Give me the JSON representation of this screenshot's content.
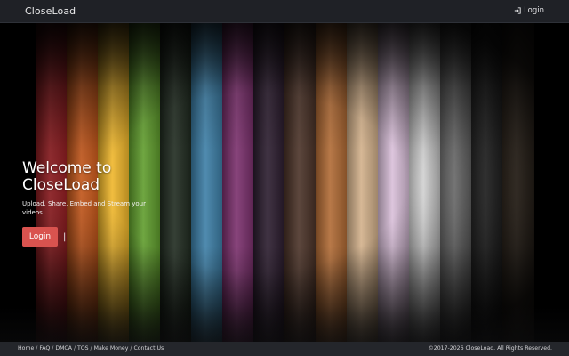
{
  "navbar": {
    "brand": "CloseLoad",
    "login_label": "Login",
    "login_icon": "sign-in-icon"
  },
  "hero": {
    "title_line1": "Welcome to",
    "title_line2": "CloseLoad",
    "subtitle": "Upload, Share, Embed and Stream your videos.",
    "login_button": "Login",
    "background_stripe_colors": [
      "#c1272d",
      "#e0641f",
      "#efb62a",
      "#5f9c2c",
      "#1f2a1f",
      "#3c7ea6",
      "#7a2f6c",
      "#2b1c2e",
      "#4a3227",
      "#b06a34",
      "#d2b08a",
      "#d9bfd9",
      "#e8e8e8",
      "#8d8d8d",
      "#3a3a3a",
      "#5a4a3a"
    ]
  },
  "footer": {
    "links": [
      "Home",
      "FAQ",
      "DMCA",
      "TOS",
      "Make Money",
      "Contact Us"
    ],
    "separator": " / ",
    "copyright": "©2017-2026 CloseLoad. All Rights Reserved."
  },
  "colors": {
    "navbar_bg": "#1f2126",
    "footer_bg": "#24262b",
    "accent_button": "#d9534f"
  }
}
